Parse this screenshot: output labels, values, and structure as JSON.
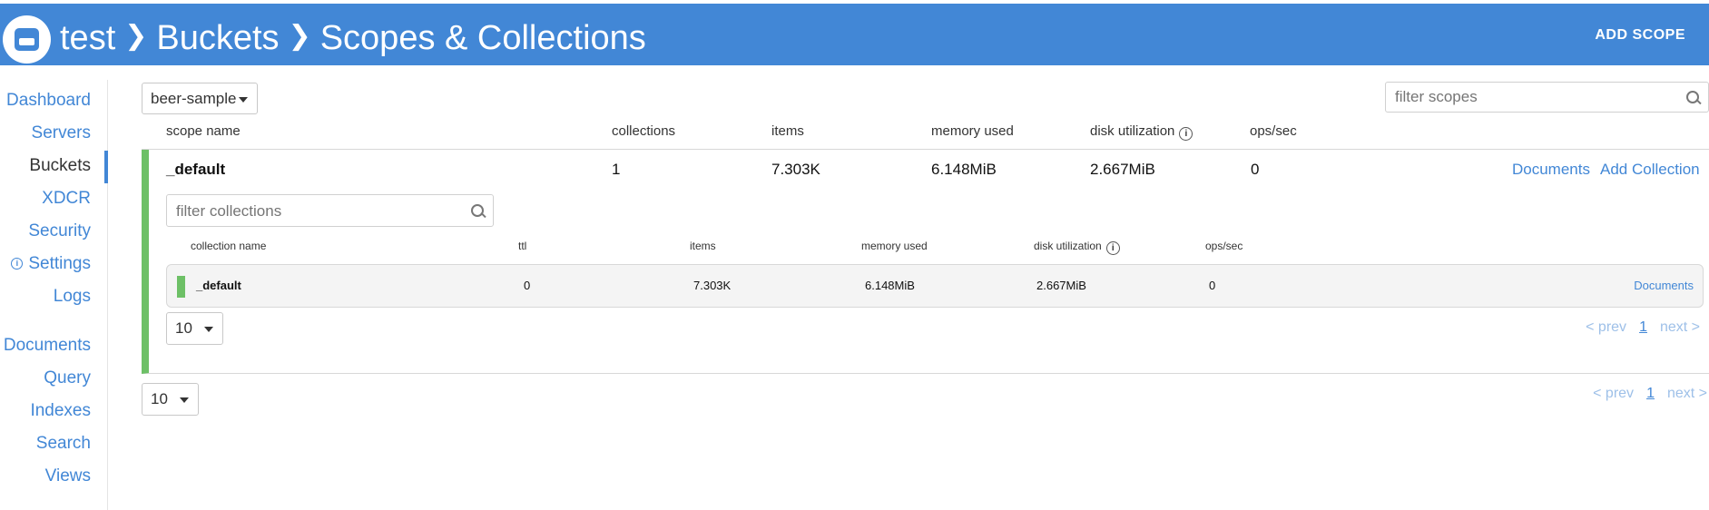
{
  "header": {
    "crumbs": [
      "test",
      "Buckets",
      "Scopes & Collections"
    ],
    "add_scope_label": "ADD SCOPE"
  },
  "sidebar": {
    "items": [
      {
        "label": "Dashboard"
      },
      {
        "label": "Servers"
      },
      {
        "label": "Buckets"
      },
      {
        "label": "XDCR"
      },
      {
        "label": "Security"
      },
      {
        "label": "Settings"
      },
      {
        "label": "Logs"
      },
      {
        "label": "Documents"
      },
      {
        "label": "Query"
      },
      {
        "label": "Indexes"
      },
      {
        "label": "Search"
      },
      {
        "label": "Views"
      }
    ],
    "active": "Buckets",
    "info_mark": "i"
  },
  "bucket_select": {
    "value": "beer-sample"
  },
  "filter_scopes": {
    "placeholder": "filter scopes"
  },
  "scope_table": {
    "headers": {
      "name": "scope name",
      "collections": "collections",
      "items": "items",
      "memory": "memory used",
      "disk": "disk utilization",
      "ops": "ops/sec"
    },
    "info_mark": "i",
    "row": {
      "name": "_default",
      "collections": "1",
      "items": "7.303K",
      "memory": "6.148MiB",
      "disk": "2.667MiB",
      "ops": "0",
      "documents_link": "Documents",
      "add_collection_link": "Add Collection"
    }
  },
  "filter_collections": {
    "placeholder": "filter collections"
  },
  "collection_table": {
    "headers": {
      "name": "collection name",
      "ttl": "ttl",
      "items": "items",
      "memory": "memory used",
      "disk": "disk utilization",
      "ops": "ops/sec"
    },
    "info_mark": "i",
    "row": {
      "name": "_default",
      "ttl": "0",
      "items": "7.303K",
      "memory": "6.148MiB",
      "disk": "2.667MiB",
      "ops": "0",
      "documents_link": "Documents"
    }
  },
  "collection_pagination": {
    "page_size": "10",
    "prev": "< prev",
    "current": "1",
    "next": "next >"
  },
  "scope_pagination": {
    "page_size": "10",
    "prev": "< prev",
    "current": "1",
    "next": "next >"
  },
  "colors": {
    "brand": "#4287d6",
    "scope_accent": "#6dc066"
  }
}
